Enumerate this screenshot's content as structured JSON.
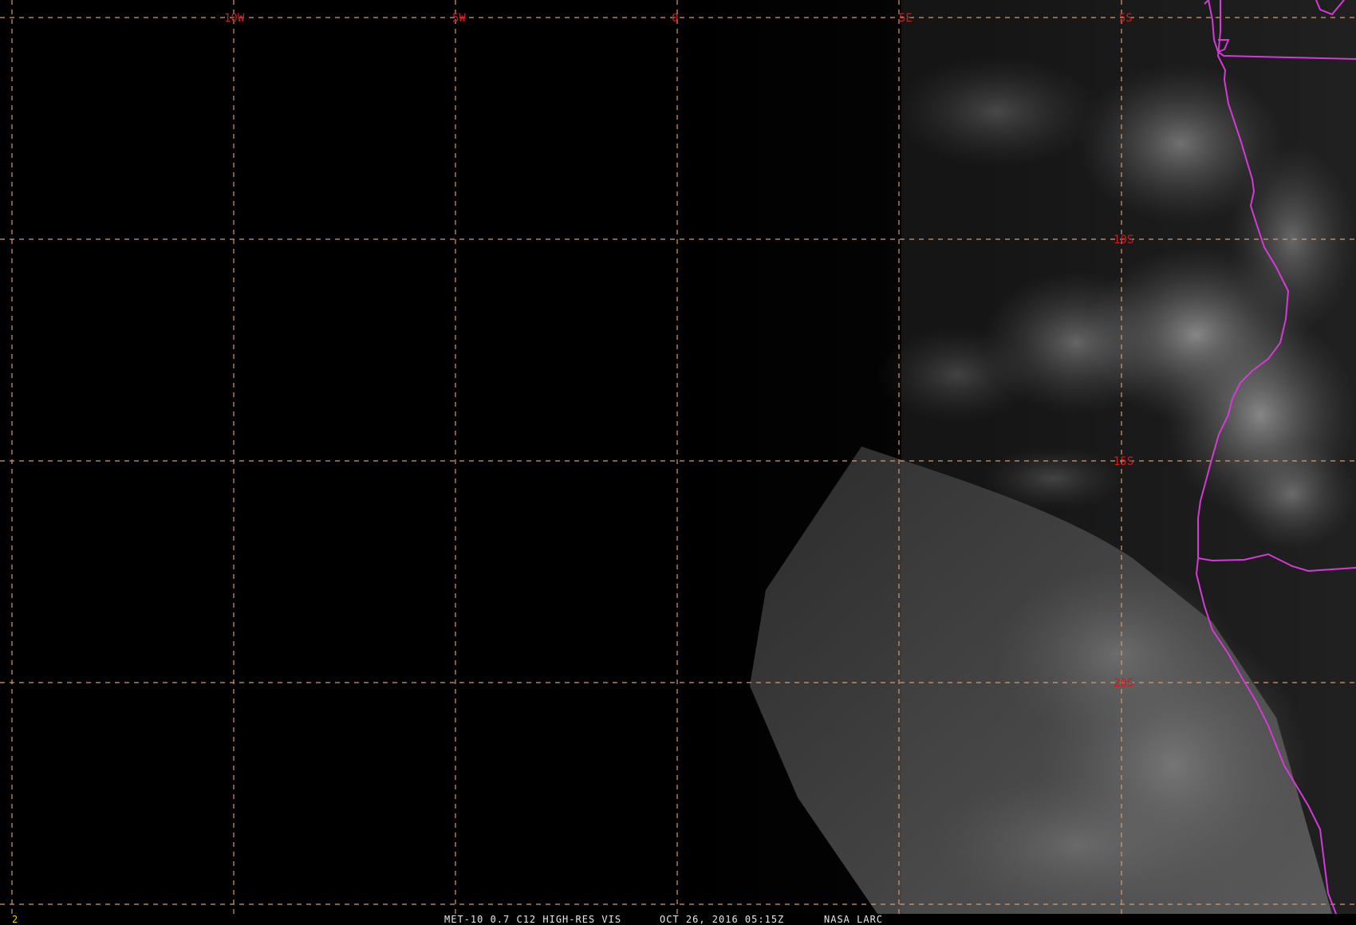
{
  "map": {
    "grid_labels": {
      "lon": [
        "10W",
        "5W",
        "0",
        "5E"
      ],
      "lat": [
        "5S",
        "10S",
        "15S",
        "20S"
      ]
    },
    "colors": {
      "grid": "#d89a6a",
      "labels": "#d11b1b",
      "coastline": "#d63ad6",
      "background": "#000000"
    }
  },
  "status": {
    "frame": "2",
    "product": "MET-10 0.7 C12 HIGH-RES VIS",
    "datetime": "OCT 26, 2016 05:15Z",
    "source": "NASA LARC"
  }
}
